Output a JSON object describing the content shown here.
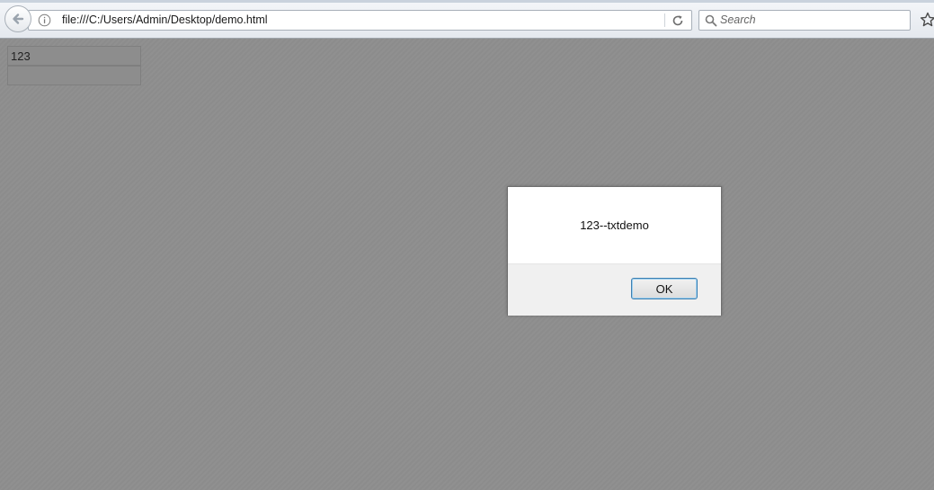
{
  "browser": {
    "url": "file:///C:/Users/Admin/Desktop/demo.html",
    "search_placeholder": "Search"
  },
  "page": {
    "text_field_1_value": "123",
    "text_field_2_value": ""
  },
  "dialog": {
    "message": "123--txtdemo",
    "ok_label": "OK"
  },
  "icons": {
    "back": "back-arrow-icon",
    "info": "info-icon",
    "reload": "reload-icon",
    "search": "search-icon",
    "bookmark": "star-icon"
  },
  "colors": {
    "overlay_background": "#8e8e8e",
    "dialog_footer": "#f0f0f0",
    "ok_border": "#3c7fb1"
  }
}
